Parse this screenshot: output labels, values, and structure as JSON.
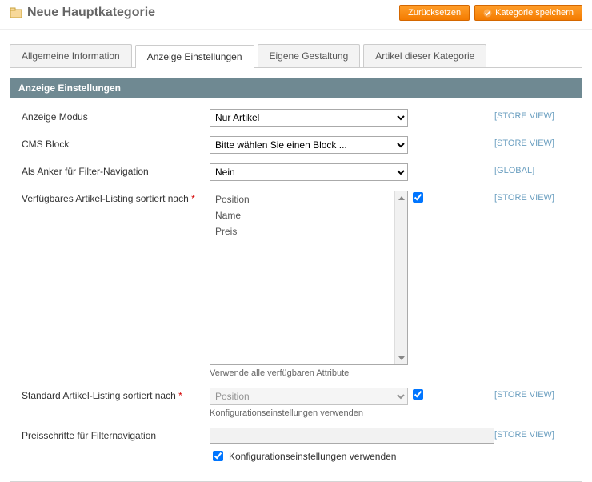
{
  "header": {
    "title": "Neue Hauptkategorie",
    "reset_label": "Zurücksetzen",
    "save_label": "Kategorie speichern"
  },
  "tabs": {
    "items": [
      {
        "label": "Allgemeine Information"
      },
      {
        "label": "Anzeige Einstellungen"
      },
      {
        "label": "Eigene Gestaltung"
      },
      {
        "label": "Artikel dieser Kategorie"
      }
    ],
    "active_index": 1
  },
  "section": {
    "title": "Anzeige Einstellungen"
  },
  "scopes": {
    "store_view": "[STORE VIEW]",
    "global": "[GLOBAL]"
  },
  "fields": {
    "display_mode": {
      "label": "Anzeige Modus",
      "value": "Nur Artikel"
    },
    "cms_block": {
      "label": "CMS Block",
      "value": "Bitte wählen Sie einen Block ..."
    },
    "is_anchor": {
      "label": "Als Anker für Filter-Navigation",
      "value": "Nein"
    },
    "available_sort": {
      "label": "Verfügbares Artikel-Listing sortiert nach",
      "required": true,
      "options": [
        "Position",
        "Name",
        "Preis"
      ],
      "hint": "Verwende alle verfügbaren Attribute",
      "use_all_checked": true
    },
    "default_sort": {
      "label": "Standard Artikel-Listing sortiert nach",
      "required": true,
      "value": "Position",
      "hint": "Konfigurationseinstellungen verwenden",
      "use_config_checked": true
    },
    "price_step": {
      "label": "Preisschritte für Filternavigation",
      "use_config_label": "Konfigurationseinstellungen verwenden",
      "use_config_checked": true
    }
  }
}
